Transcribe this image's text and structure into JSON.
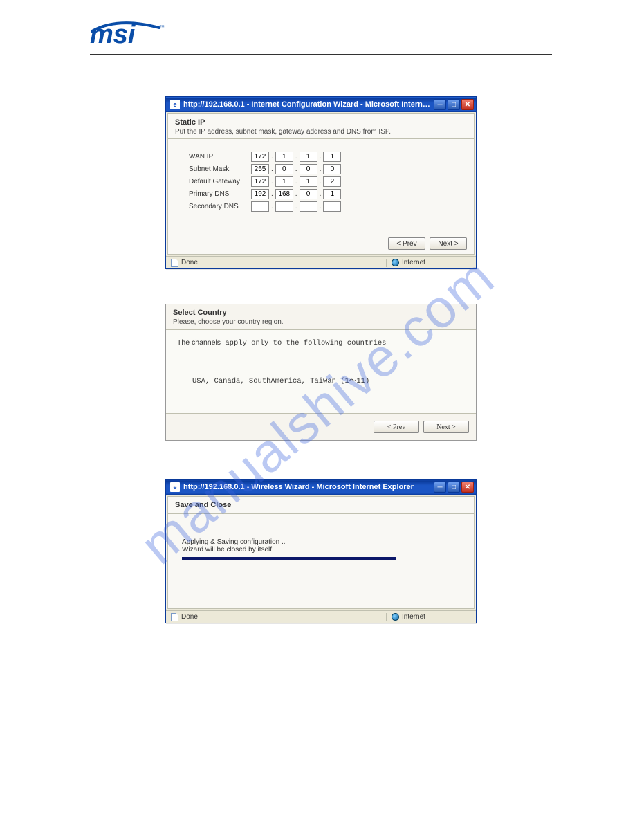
{
  "watermark": "manualshive.com",
  "logo_text": "msi",
  "window1": {
    "title": "http://192.168.0.1 - Internet Configuration Wizard - Microsoft Internet...",
    "heading": "Static IP",
    "subheading": "Put the IP address, subnet mask, gateway address and DNS from ISP.",
    "fields": {
      "wan_ip": {
        "label": "WAN IP",
        "octets": [
          "172",
          "1",
          "1",
          "1"
        ]
      },
      "subnet_mask": {
        "label": "Subnet Mask",
        "octets": [
          "255",
          "0",
          "0",
          "0"
        ]
      },
      "default_gateway": {
        "label": "Default Gateway",
        "octets": [
          "172",
          "1",
          "1",
          "2"
        ]
      },
      "primary_dns": {
        "label": "Primary DNS",
        "octets": [
          "192",
          "168",
          "0",
          "1"
        ]
      },
      "secondary_dns": {
        "label": "Secondary DNS",
        "octets": [
          "",
          "",
          "",
          ""
        ]
      }
    },
    "buttons": {
      "prev": "< Prev",
      "next": "Next >"
    },
    "status_left": "Done",
    "status_right": "Internet"
  },
  "panel2": {
    "heading": "Select Country",
    "subheading": "Please, choose your country region.",
    "channels_prefix": "The channels",
    "channels_mono": " apply only to the following countries",
    "countries": "USA, Canada, SouthAmerica, Taiwan (1～11)",
    "buttons": {
      "prev": "< Prev",
      "next": "Next >"
    }
  },
  "window3": {
    "title": "http://192.168.0.1 - Wireless Wizard - Microsoft Internet Explorer",
    "heading": "Save and Close",
    "line1": "Applying & Saving configuration ..",
    "line2": "Wizard will be closed by itself",
    "status_left": "Done",
    "status_right": "Internet"
  }
}
